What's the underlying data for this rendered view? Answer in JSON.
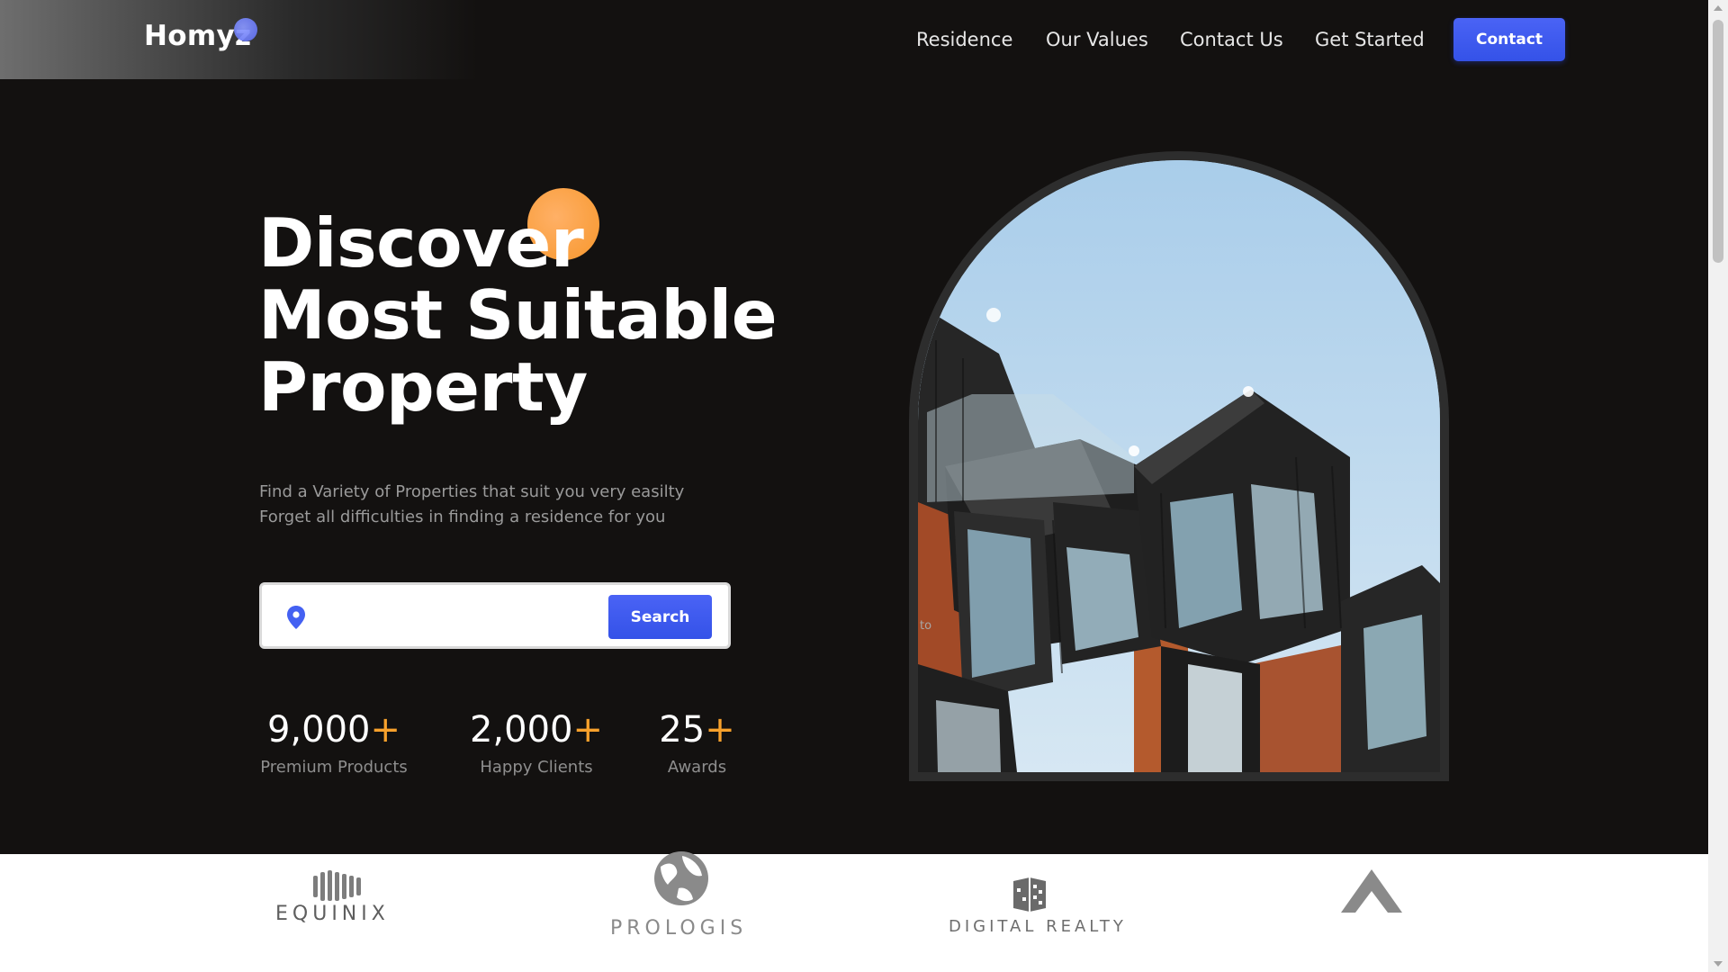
{
  "header": {
    "logo": "Homyz",
    "nav": [
      "Residence",
      "Our Values",
      "Contact Us",
      "Get Started"
    ],
    "contact_button": "Contact"
  },
  "hero": {
    "title_lines": [
      "Discover",
      "Most Suitable",
      "Property"
    ],
    "subtitle_lines": [
      "Find a Variety of Properties that suit you very easilty",
      "Forget all difficulties in finding a residence for you"
    ],
    "search": {
      "icon": "location-pin-icon",
      "placeholder": "",
      "button": "Search"
    },
    "stats": [
      {
        "value": "9,000",
        "suffix": "+",
        "label": "Premium Products"
      },
      {
        "value": "2,000",
        "suffix": "+",
        "label": "Happy Clients"
      },
      {
        "value": "25",
        "suffix": "+",
        "label": "Awards"
      }
    ],
    "image_alt_text": "to"
  },
  "brands": {
    "names": [
      "EQUINIX",
      "PROLOGIS",
      "DIGITAL REALTY",
      ""
    ]
  },
  "colors": {
    "background": "#131110",
    "accent_blue": "#3d5af1",
    "accent_orange": "#f7a12c",
    "text_muted": "#9a9a9a"
  }
}
